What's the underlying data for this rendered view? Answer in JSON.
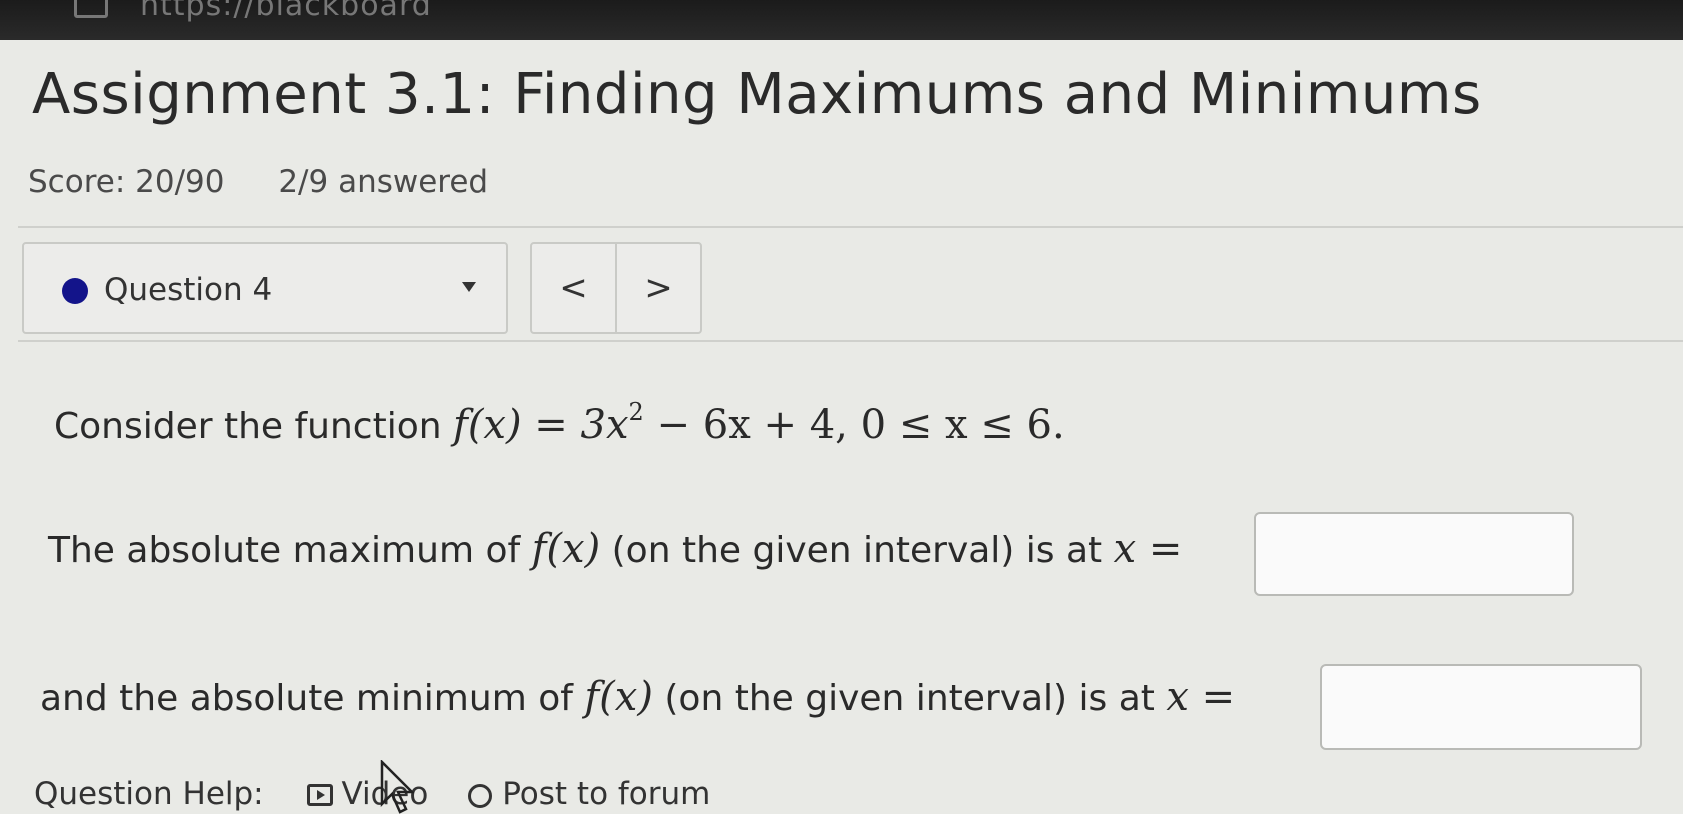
{
  "browser": {
    "url_fragment": "https://blackboard"
  },
  "page": {
    "title": "Assignment 3.1: Finding Maximums and Minimums",
    "score": "Score: 20/90",
    "answered": "2/9 answered"
  },
  "question_nav": {
    "selected": "Question 4",
    "prev_label": "<",
    "next_label": ">",
    "status_color": "#13148a"
  },
  "question": {
    "intro": "Consider the function",
    "function_expr": {
      "lhs": "f(x) = 3x",
      "exponent": "2",
      "rhs": " − 6x + 4,   0 ≤ x ≤ 6."
    },
    "max_prompt_before": "The absolute maximum of",
    "max_prompt_fx": "f(x)",
    "max_prompt_after": "(on the given interval) is at",
    "min_prompt_before": "and the absolute minimum of",
    "min_prompt_fx": "f(x)",
    "min_prompt_after": "(on the given interval) is at",
    "x_equals": "x =",
    "max_answer": "",
    "min_answer": ""
  },
  "help": {
    "label": "Question Help:",
    "video_label": "Video",
    "forum_label": "Post to forum"
  }
}
